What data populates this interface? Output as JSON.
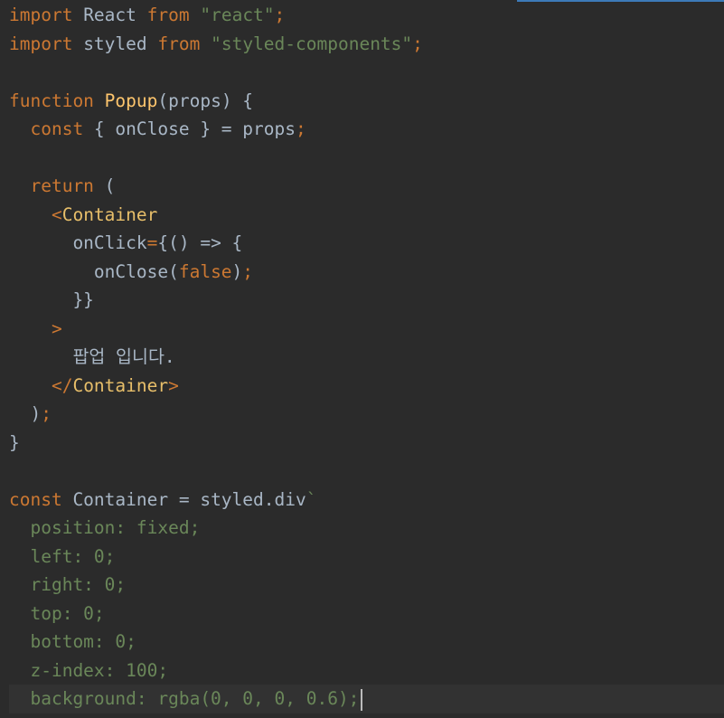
{
  "editor": {
    "lines": [
      [
        {
          "t": "import",
          "c": "kw"
        },
        {
          "t": " React ",
          "c": "plain"
        },
        {
          "t": "from",
          "c": "kw"
        },
        {
          "t": " ",
          "c": "plain"
        },
        {
          "t": "\"react\"",
          "c": "str"
        },
        {
          "t": ";",
          "c": "punct"
        }
      ],
      [
        {
          "t": "import",
          "c": "kw"
        },
        {
          "t": " styled ",
          "c": "plain"
        },
        {
          "t": "from",
          "c": "kw"
        },
        {
          "t": " ",
          "c": "plain"
        },
        {
          "t": "\"styled-components\"",
          "c": "str"
        },
        {
          "t": ";",
          "c": "punct"
        }
      ],
      [],
      [
        {
          "t": "function",
          "c": "kw"
        },
        {
          "t": " ",
          "c": "plain"
        },
        {
          "t": "Popup",
          "c": "fn"
        },
        {
          "t": "(props) {",
          "c": "plain"
        }
      ],
      [
        {
          "t": "  ",
          "c": "plain"
        },
        {
          "t": "const",
          "c": "kw"
        },
        {
          "t": " { onClose } = props",
          "c": "plain"
        },
        {
          "t": ";",
          "c": "punct"
        }
      ],
      [],
      [
        {
          "t": "  ",
          "c": "plain"
        },
        {
          "t": "return",
          "c": "kw"
        },
        {
          "t": " (",
          "c": "plain"
        }
      ],
      [
        {
          "t": "    ",
          "c": "plain"
        },
        {
          "t": "<",
          "c": "punct"
        },
        {
          "t": "Container",
          "c": "tag"
        }
      ],
      [
        {
          "t": "      onClick",
          "c": "plain"
        },
        {
          "t": "=",
          "c": "punct"
        },
        {
          "t": "{() => {",
          "c": "plain"
        }
      ],
      [
        {
          "t": "        onClose(",
          "c": "plain"
        },
        {
          "t": "false",
          "c": "kw"
        },
        {
          "t": ")",
          "c": "plain"
        },
        {
          "t": ";",
          "c": "punct"
        }
      ],
      [
        {
          "t": "      }}",
          "c": "plain"
        }
      ],
      [
        {
          "t": "    ",
          "c": "plain"
        },
        {
          "t": ">",
          "c": "punct"
        }
      ],
      [
        {
          "t": "      팝업 입니다.",
          "c": "plain"
        }
      ],
      [
        {
          "t": "    ",
          "c": "plain"
        },
        {
          "t": "</",
          "c": "punct"
        },
        {
          "t": "Container",
          "c": "tag"
        },
        {
          "t": ">",
          "c": "punct"
        }
      ],
      [
        {
          "t": "  )",
          "c": "plain"
        },
        {
          "t": ";",
          "c": "punct"
        }
      ],
      [
        {
          "t": "}",
          "c": "plain"
        }
      ],
      [],
      [
        {
          "t": "const",
          "c": "kw"
        },
        {
          "t": " Container = styled.div",
          "c": "plain"
        },
        {
          "t": "`",
          "c": "str"
        }
      ],
      [
        {
          "t": "  position: fixed;",
          "c": "css"
        }
      ],
      [
        {
          "t": "  left: 0;",
          "c": "css"
        }
      ],
      [
        {
          "t": "  right: 0;",
          "c": "css"
        }
      ],
      [
        {
          "t": "  top: 0;",
          "c": "css"
        }
      ],
      [
        {
          "t": "  bottom: 0;",
          "c": "css"
        }
      ],
      [
        {
          "t": "  z-index: 100;",
          "c": "css"
        }
      ],
      [
        {
          "t": "  background: rgba(0, 0, 0, 0.6);",
          "c": "css"
        }
      ]
    ],
    "current_line": 25
  }
}
